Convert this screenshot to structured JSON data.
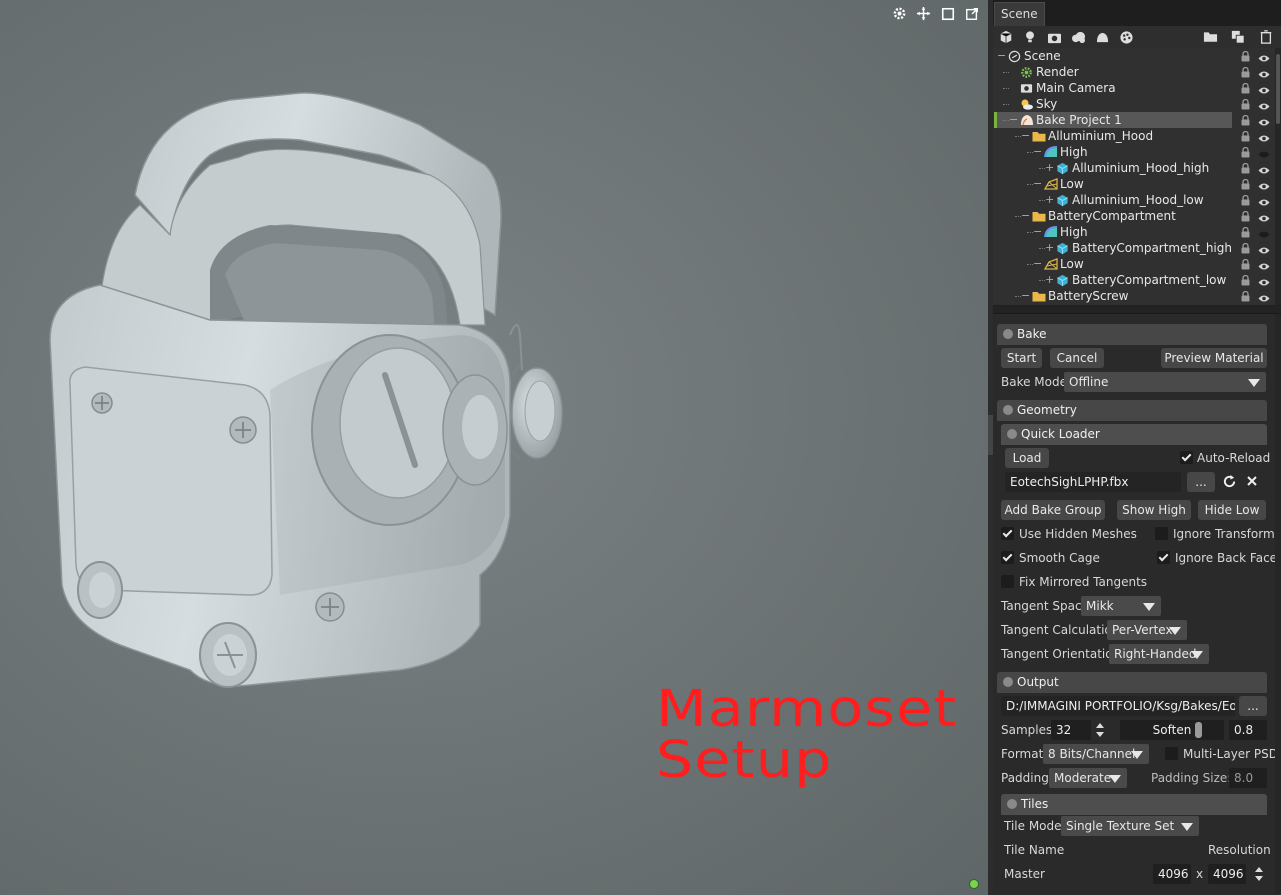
{
  "viewport": {
    "overlay_title": "Marmoset\nSetup",
    "toolbar": [
      "settings-icon",
      "move-icon",
      "frame-icon",
      "popout-icon"
    ]
  },
  "scene_panel": {
    "tab": "Scene",
    "tree": [
      {
        "label": "Scene",
        "depth": 0,
        "icon": "scene-icon",
        "expander": "−"
      },
      {
        "label": "Render",
        "depth": 1,
        "icon": "gear-icon",
        "expander": ""
      },
      {
        "label": "Main Camera",
        "depth": 1,
        "icon": "camera-icon",
        "expander": ""
      },
      {
        "label": "Sky",
        "depth": 1,
        "icon": "sky-icon",
        "expander": ""
      },
      {
        "label": "Bake Project 1",
        "depth": 1,
        "icon": "bake-project-icon",
        "expander": "−",
        "selected": true
      },
      {
        "label": "Alluminium_Hood",
        "depth": 2,
        "icon": "folder-icon",
        "expander": "−"
      },
      {
        "label": "High",
        "depth": 3,
        "icon": "high-poly-icon",
        "expander": "−"
      },
      {
        "label": "Alluminium_Hood_high",
        "depth": 4,
        "icon": "mesh-icon",
        "expander": "+"
      },
      {
        "label": "Low",
        "depth": 3,
        "icon": "low-poly-icon",
        "expander": "−"
      },
      {
        "label": "Alluminium_Hood_low",
        "depth": 4,
        "icon": "mesh-icon",
        "expander": "+"
      },
      {
        "label": "BatteryCompartment",
        "depth": 2,
        "icon": "folder-icon",
        "expander": "−"
      },
      {
        "label": "High",
        "depth": 3,
        "icon": "high-poly-icon",
        "expander": "−"
      },
      {
        "label": "BatteryCompartment_high",
        "depth": 4,
        "icon": "mesh-icon",
        "expander": "+"
      },
      {
        "label": "Low",
        "depth": 3,
        "icon": "low-poly-icon",
        "expander": "−"
      },
      {
        "label": "BatteryCompartment_low",
        "depth": 4,
        "icon": "mesh-icon",
        "expander": "+"
      },
      {
        "label": "BatteryScrew",
        "depth": 2,
        "icon": "folder-icon",
        "expander": "−"
      }
    ]
  },
  "bake": {
    "section": "Bake",
    "start": "Start",
    "cancel": "Cancel",
    "preview_material": "Preview Material",
    "bake_mode_label": "Bake Mode",
    "bake_mode_value": "Offline"
  },
  "geometry": {
    "section": "Geometry",
    "quick_loader": "Quick Loader",
    "load": "Load",
    "auto_reload": "Auto-Reload",
    "file_name": "EotechSighLPHP.fbx",
    "browse": "...",
    "add_bake_group": "Add Bake Group",
    "show_high": "Show High",
    "hide_low": "Hide Low",
    "use_hidden_meshes": "Use Hidden Meshes",
    "ignore_transforms": "Ignore Transforms",
    "smooth_cage": "Smooth Cage",
    "ignore_back_faces": "Ignore Back Faces",
    "fix_mirrored_tangents": "Fix Mirrored Tangents",
    "tangent_space_label": "Tangent Space",
    "tangent_space_value": "Mikk",
    "tangent_calc_label": "Tangent Calculation",
    "tangent_calc_value": "Per-Vertex",
    "tangent_orient_label": "Tangent Orientation",
    "tangent_orient_value": "Right-Handed"
  },
  "output": {
    "section": "Output",
    "path": "D:/IMMAGINI PORTFOLIO/Ksg/Bakes/Eotech",
    "browse": "...",
    "samples_label": "Samples:",
    "samples_value": "32",
    "soften_label": "Soften",
    "soften_value": "0.8",
    "format_label": "Format",
    "format_value": "8 Bits/Channel",
    "multi_layer_psd": "Multi-Layer PSD",
    "padding_label": "Padding",
    "padding_value": "Moderate",
    "padding_size_label": "Padding Size:",
    "padding_size_value": "8.0"
  },
  "tiles": {
    "section": "Tiles",
    "tile_mode_label": "Tile Mode",
    "tile_mode_value": "Single Texture Set",
    "tile_name_label": "Tile Name",
    "resolution_label": "Resolution",
    "master_label": "Master",
    "res_w": "4096",
    "res_x": "x",
    "res_h": "4096"
  },
  "checkbox_states": {
    "auto_reload": 1.0,
    "use_hidden_meshes": 1.0,
    "ignore_transforms": 0.0,
    "smooth_cage": 1.0,
    "ignore_back_faces": 1.0,
    "fix_mirrored_tangents": 0.0,
    "multi_layer_psd": 0.0
  },
  "soften_slider_value": 0.8,
  "colors": {
    "overlay_text": "#ff1d1d",
    "selection_marker": "#7ab240",
    "status_dot": "#7cd34a"
  }
}
